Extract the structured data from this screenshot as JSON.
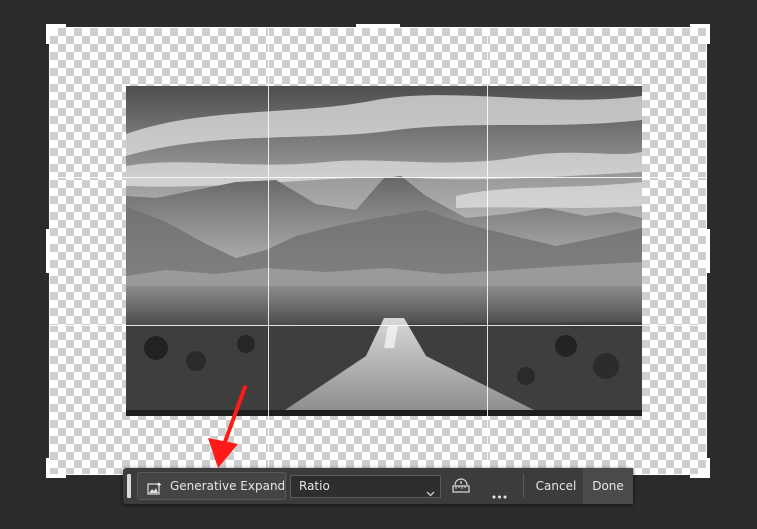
{
  "toolbar": {
    "generative_expand_label": "Generative Expand",
    "ratio_value": "Ratio",
    "cancel_label": "Cancel",
    "done_label": "Done"
  },
  "icons": {
    "generative_expand": "generative-expand-icon",
    "ratio_dropdown": "chevron-down-icon",
    "straighten": "straighten-icon",
    "more": "more-options-icon"
  },
  "colors": {
    "canvas_bg": "#2b2b2b",
    "toolbar_bg": "#3c3c3c",
    "arrow": "#ff1a1a"
  }
}
